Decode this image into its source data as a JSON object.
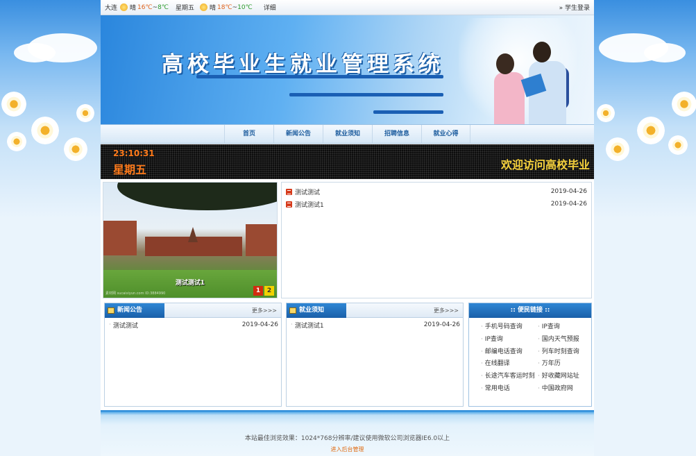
{
  "weather": [
    {
      "city": "大连",
      "condition": "晴",
      "temp_hi": "16℃",
      "sep": "~",
      "temp_lo": "8℃"
    },
    {
      "city": "星期五",
      "condition": "晴",
      "temp_hi": "18℃",
      "sep": "~",
      "temp_lo": "10℃"
    }
  ],
  "weather_detail": "详细",
  "login_link": "» 学生登录",
  "banner_title": "高校毕业生就业管理系统",
  "nav": [
    "首页",
    "新闻公告",
    "就业须知",
    "招聘信息",
    "就业心得"
  ],
  "led": {
    "time": "23:10:31",
    "day": "星期五",
    "welcome": "欢迎访问高校毕业"
  },
  "slideshow": {
    "caption": "测试测试1",
    "numbers": [
      "1",
      "2"
    ],
    "watermark": "素材网 sucaixiyun.com  ID:3884990"
  },
  "news_list": [
    {
      "title": "测试测试",
      "date": "2019-04-26"
    },
    {
      "title": "测试测试1",
      "date": "2019-04-26"
    }
  ],
  "panels": {
    "news": {
      "title": "新闻公告",
      "more": "更多>>>",
      "items": [
        {
          "title": "测试测试",
          "date": "2019-04-26"
        }
      ]
    },
    "notice": {
      "title": "就业须知",
      "more": "更多>>>",
      "items": [
        {
          "title": "测试测试1",
          "date": "2019-04-26"
        }
      ]
    }
  },
  "links": {
    "title": ":: 便民链接 ::",
    "items": [
      "手机号码查询",
      "IP查询",
      "IP查询",
      "国内天气预报",
      "邮编电话查询",
      "列车时刻查询",
      "在线翻译",
      "万年历",
      "长途汽车客运时刻",
      "好收藏网站址",
      "常用电话",
      "中国政府网"
    ]
  },
  "footer": {
    "notice": "本站最佳浏览效果：1024*768分辨率/建议使用微软公司浏览器IE6.0以上",
    "admin_link": "进入后台管理"
  }
}
